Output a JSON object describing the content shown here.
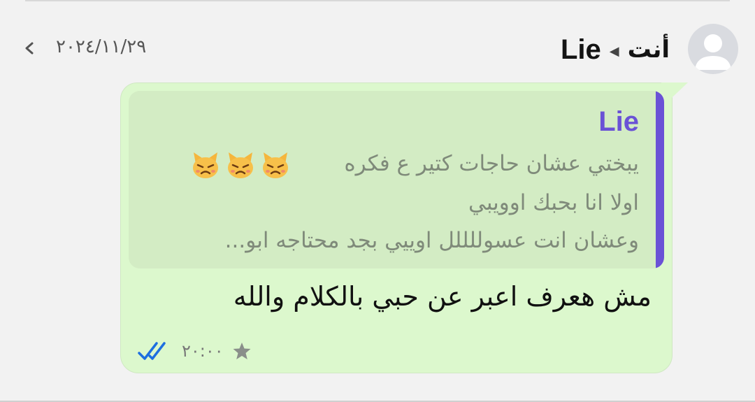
{
  "header": {
    "sender_label": "أنت",
    "recipient_name": "Lie",
    "date": "٢٠٢٤/١١/٢٩"
  },
  "quote": {
    "author": "Lie",
    "lines": [
      "يبختي عشان حاجات كتير ع فكره",
      "اولا انا بحبك اوويبي",
      "وعشان انت عسوللللل اوييي بجد محتاجه ابو..."
    ],
    "emoji_icons": [
      "cat-face-icon",
      "cat-face-icon",
      "cat-face-icon"
    ]
  },
  "message": {
    "text": "مش هعرف اعبر عن حبي بالكلام والله",
    "time": "٢٠:٠٠",
    "starred": true,
    "read_status": "read"
  },
  "colors": {
    "bubble": "#dcf8cd",
    "quote_background": "#d3ecc4",
    "quote_accent": "#6a52d6",
    "check_marks": "#1d6fe0",
    "page_background": "#f2f2f2"
  }
}
